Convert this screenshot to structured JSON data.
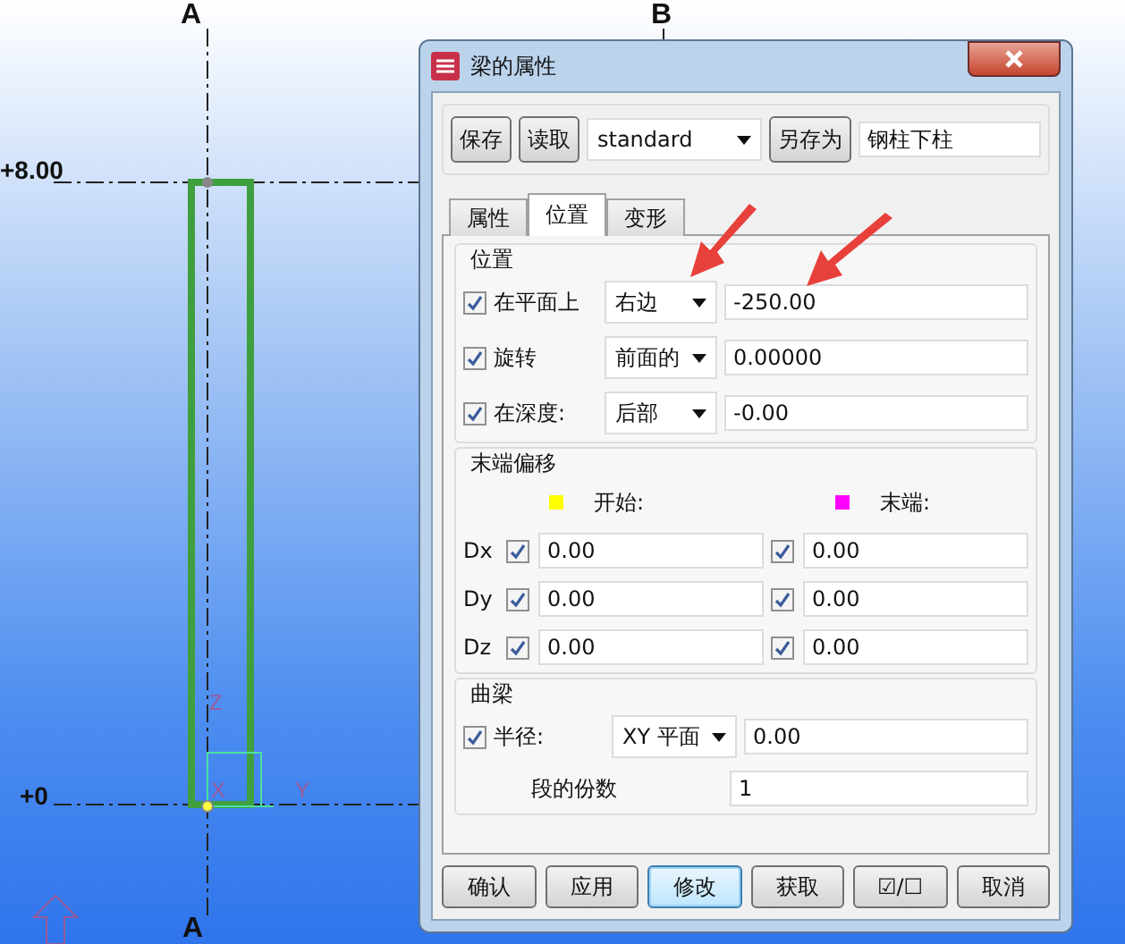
{
  "canvas": {
    "labels": [
      {
        "kind": "grid",
        "text": "A"
      },
      {
        "kind": "grid",
        "text": "B"
      },
      {
        "kind": "level",
        "text": "+8.00"
      },
      {
        "kind": "level",
        "text": "+0"
      },
      {
        "kind": "grid",
        "text": "A"
      }
    ],
    "axes": [
      "Z",
      "X",
      "Y"
    ]
  },
  "dialog": {
    "title": "梁的属性",
    "toolbar": {
      "save": "保存",
      "load": "读取",
      "preset": "standard",
      "save_as": "另存为",
      "name": "钢柱下柱"
    },
    "tabs": [
      {
        "label": "属性",
        "selected": false
      },
      {
        "label": "位置",
        "selected": true
      },
      {
        "label": "变形",
        "selected": false
      }
    ],
    "position": {
      "title": "位置",
      "rows": [
        {
          "label": "在平面上",
          "checked": true,
          "option": "右边",
          "value": "-250.00"
        },
        {
          "label": "旋转",
          "checked": true,
          "option": "前面的",
          "value": "0.00000"
        },
        {
          "label": "在深度:",
          "checked": true,
          "option": "后部",
          "value": "-0.00"
        }
      ]
    },
    "end_offset": {
      "title": "末端偏移",
      "columns": [
        {
          "label": "开始:",
          "color": "#ffff00"
        },
        {
          "label": "末端:",
          "color": "#ff00ff"
        }
      ],
      "rows": [
        {
          "axis": "Dx",
          "start": {
            "checked": true,
            "value": "0.00"
          },
          "end": {
            "checked": true,
            "value": "0.00"
          }
        },
        {
          "axis": "Dy",
          "start": {
            "checked": true,
            "value": "0.00"
          },
          "end": {
            "checked": true,
            "value": "0.00"
          }
        },
        {
          "axis": "Dz",
          "start": {
            "checked": true,
            "value": "0.00"
          },
          "end": {
            "checked": true,
            "value": "0.00"
          }
        }
      ]
    },
    "curved": {
      "title": "曲梁",
      "radius": {
        "label": "半径:",
        "checked": true,
        "option": "XY 平面",
        "value": "0.00"
      },
      "segments": {
        "label": "段的份数",
        "value": "1"
      }
    },
    "buttons": [
      {
        "label": "确认",
        "focused": false
      },
      {
        "label": "应用",
        "focused": false
      },
      {
        "label": "修改",
        "focused": true
      },
      {
        "label": "获取",
        "focused": false
      },
      {
        "label": "☑/☐",
        "focused": false
      },
      {
        "label": "取消",
        "focused": false
      }
    ]
  }
}
